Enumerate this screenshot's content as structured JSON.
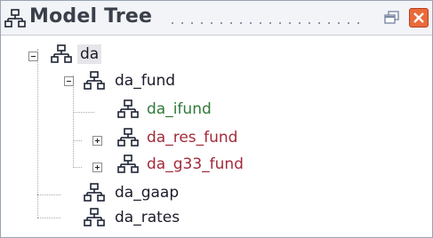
{
  "panel": {
    "title": "Model Tree",
    "controls": {
      "restore_icon": "restore-icon",
      "close_icon": "close-icon"
    }
  },
  "tree": {
    "nodes": [
      {
        "label": "da",
        "icon": "hierarchy-icon",
        "expander": "minus",
        "color": "#1b1b2a"
      },
      {
        "label": "da_fund",
        "icon": "hierarchy-icon",
        "expander": "minus",
        "color": "#1b1b2a"
      },
      {
        "label": "da_ifund",
        "icon": "hierarchy-icon",
        "expander": "none",
        "color": "#2f7a3a"
      },
      {
        "label": "da_res_fund",
        "icon": "hierarchy-icon",
        "expander": "plus",
        "color": "#a32a3a"
      },
      {
        "label": "da_g33_fund",
        "icon": "hierarchy-icon",
        "expander": "plus",
        "color": "#a32a3a"
      },
      {
        "label": "da_gaap",
        "icon": "hierarchy-icon",
        "expander": "none",
        "color": "#1b1b2a"
      },
      {
        "label": "da_rates",
        "icon": "hierarchy-icon",
        "expander": "none",
        "color": "#1b1b2a"
      }
    ]
  }
}
